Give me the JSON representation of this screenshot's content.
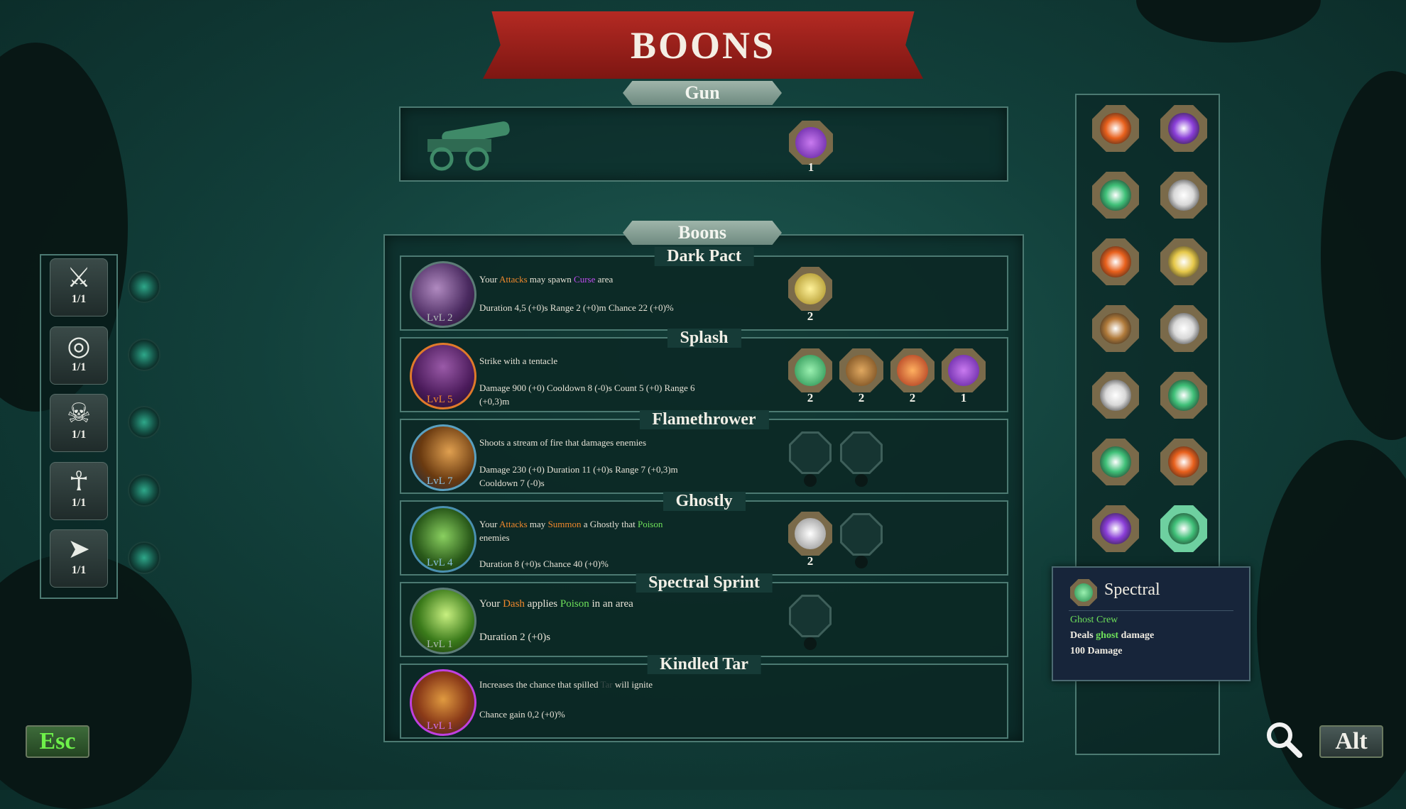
{
  "title": "BOONS",
  "gun_section": {
    "label": "Gun",
    "gem_count": "1"
  },
  "boons_section": {
    "label": "Boons",
    "rows": [
      {
        "name": "Dark Pact",
        "level": "LvL 2",
        "desc": [
          "Your ",
          "Attacks",
          " may spawn ",
          "Curse",
          " area"
        ],
        "stats": "Duration 4,5 (+0)s Range 2 (+0)m Chance 22 (+0)%",
        "gems": [
          {
            "count": "2",
            "color": "#e6c84a"
          }
        ],
        "empty_slots": 0
      },
      {
        "name": "Splash",
        "level": "LvL 5",
        "desc": "Strike with a tentacle",
        "stats": "Damage 900 (+0) Cooldown 8 (-0)s Count 5 (+0) Range 6 (+0,3)m",
        "gems": [
          {
            "count": "2",
            "color": "#3fc078"
          },
          {
            "count": "2",
            "color": "#b07a3a"
          },
          {
            "count": "2",
            "color": "#e0602a"
          },
          {
            "count": "1",
            "color": "#8a3ed8"
          }
        ],
        "empty_slots": 0
      },
      {
        "name": "Flamethrower",
        "level": "LvL 7",
        "desc": "Shoots a stream of fire that damages enemies",
        "stats": "Damage 230 (+0) Duration 11 (+0)s Range 7 (+0,3)m Cooldown 7 (-0)s",
        "gems": [],
        "empty_slots": 2
      },
      {
        "name": "Ghostly",
        "level": "LvL 4",
        "desc": [
          "Your ",
          "Attacks",
          " may ",
          "Summon",
          " a Ghostly that ",
          "Poison",
          " enemies"
        ],
        "stats": "Duration 8 (+0)s Chance 40 (+0)%",
        "gems": [
          {
            "count": "2",
            "color": "#d8d8d8"
          }
        ],
        "empty_slots": 1
      },
      {
        "name": "Spectral Sprint",
        "level": "LvL 1",
        "desc": [
          "Your ",
          "Dash",
          " applies ",
          "Poison",
          " in an area"
        ],
        "stats": "Duration 2 (+0)s",
        "gems": [],
        "empty_slots": 1
      },
      {
        "name": "Kindled Tar",
        "level": "LvL 1",
        "desc": [
          "Increases the chance that spilled ",
          "Tar",
          " will ignite"
        ],
        "stats": "Chance gain 0,2 (+0)%",
        "gems": [],
        "empty_slots": 0
      }
    ]
  },
  "abilities": [
    {
      "icon": "sword-icon",
      "count": "1/1"
    },
    {
      "icon": "target-arrow-icon",
      "count": "1/1"
    },
    {
      "icon": "skull-ring-icon",
      "count": "1/1"
    },
    {
      "icon": "skeleton-icon",
      "count": "1/1"
    },
    {
      "icon": "dash-boot-icon",
      "count": "1/1"
    }
  ],
  "inventory_gems": [
    {
      "color": "#e8601c"
    },
    {
      "color": "#8a3ed8"
    },
    {
      "color": "#3fc078"
    },
    {
      "color": "#d8d8d8"
    },
    {
      "color": "#e8601c"
    },
    {
      "color": "#e6c84a"
    },
    {
      "color": "#b07a3a"
    },
    {
      "color": "#d8d8d8"
    },
    {
      "color": "#d8d8d8"
    },
    {
      "color": "#3fc078"
    },
    {
      "color": "#3fc078"
    },
    {
      "color": "#e8601c"
    },
    {
      "color": "#8a3ed8"
    },
    {
      "color": "#3fc078"
    }
  ],
  "tooltip": {
    "title": "Spectral",
    "subtitle": "Ghost Crew",
    "line1_pre": "Deals ",
    "line1_kw": "ghost",
    "line1_post": " damage",
    "line2": "100 Damage"
  },
  "keys": {
    "esc": "Esc",
    "alt": "Alt"
  },
  "colors": {
    "banner": "#9e211b",
    "accent_orange": "#f0882c",
    "accent_purple": "#c04cf0",
    "accent_green": "#6ee05a",
    "number_blue": "#7fb8d8"
  }
}
